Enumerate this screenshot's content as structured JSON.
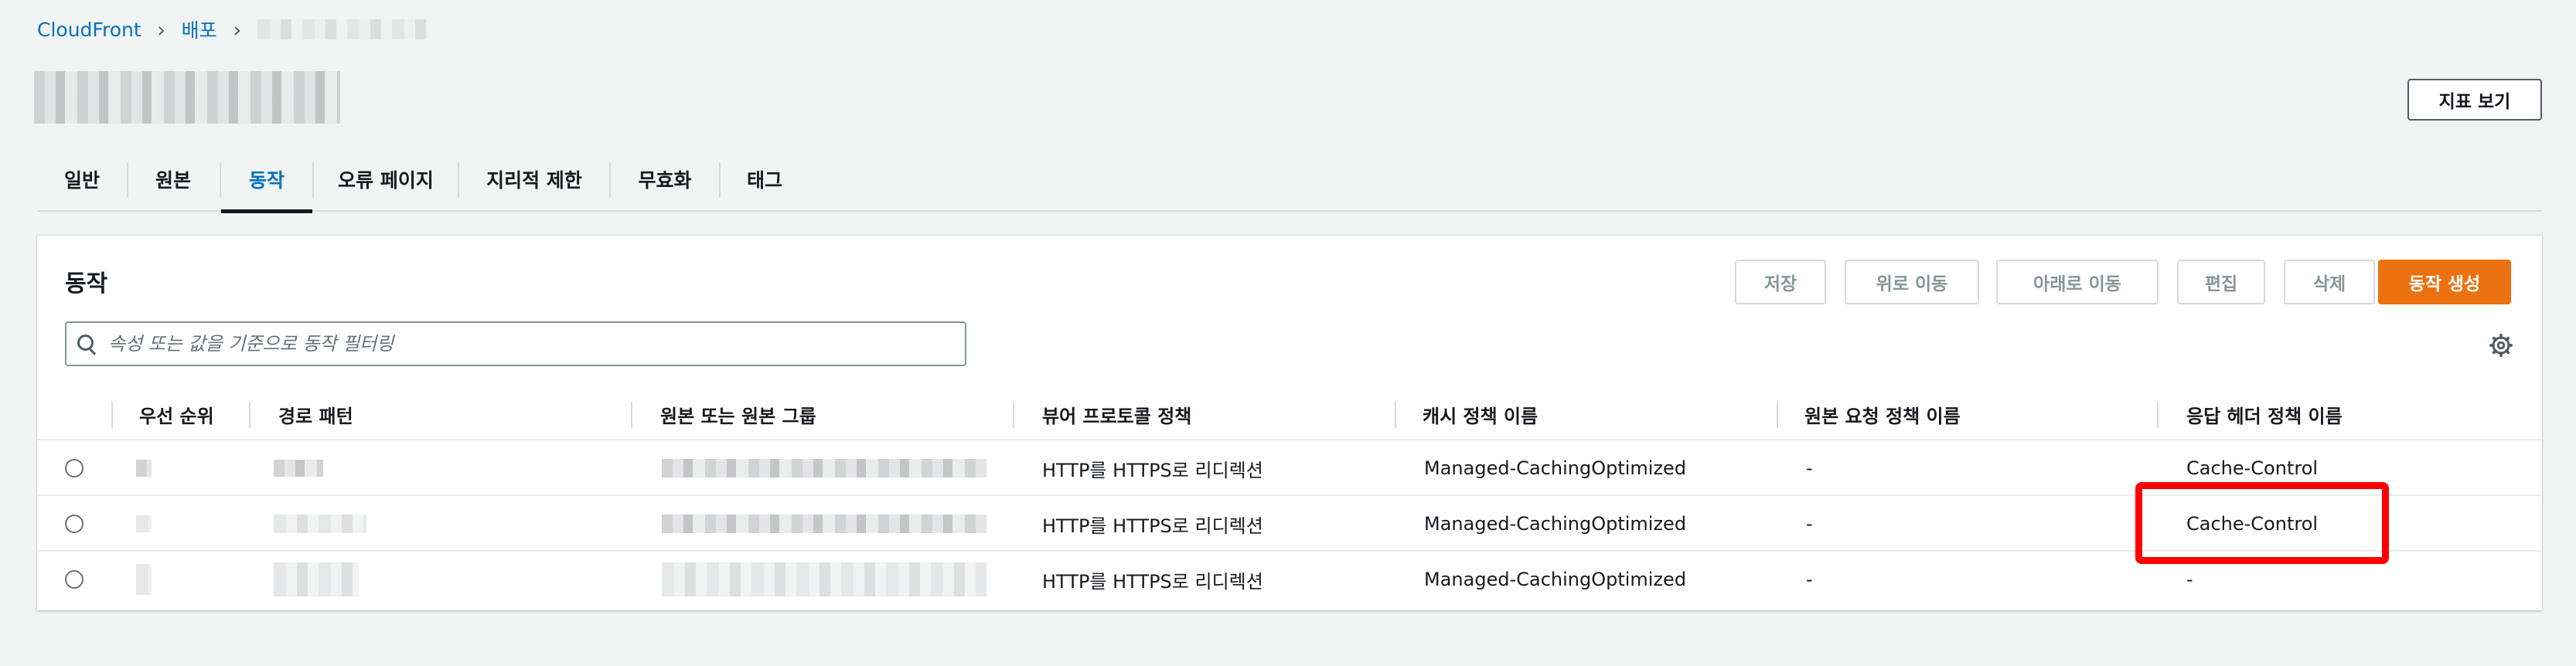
{
  "breadcrumb": {
    "root": "CloudFront",
    "section": "배포"
  },
  "header": {
    "metrics_button": "지표 보기"
  },
  "tabs": [
    {
      "label": "일반",
      "active": false
    },
    {
      "label": "원본",
      "active": false
    },
    {
      "label": "동작",
      "active": true
    },
    {
      "label": "오류 페이지",
      "active": false
    },
    {
      "label": "지리적 제한",
      "active": false
    },
    {
      "label": "무효화",
      "active": false
    },
    {
      "label": "태그",
      "active": false
    }
  ],
  "panel": {
    "title": "동작",
    "buttons": {
      "save": "저장",
      "move_up": "위로 이동",
      "move_down": "아래로 이동",
      "edit": "편집",
      "delete": "삭제",
      "create": "동작 생성"
    },
    "search_placeholder": "속성 또는 값을 기준으로 동작 필터링"
  },
  "table": {
    "columns": [
      "우선 순위",
      "경로 패턴",
      "원본 또는 원본 그룹",
      "뷰어 프로토콜 정책",
      "캐시 정책 이름",
      "원본 요청 정책 이름",
      "응답 헤더 정책 이름"
    ],
    "rows": [
      {
        "viewer_protocol": "HTTP를 HTTPS로 리디렉션",
        "cache_policy": "Managed-CachingOptimized",
        "origin_request_policy": "-",
        "response_headers_policy": "Cache-Control"
      },
      {
        "viewer_protocol": "HTTP를 HTTPS로 리디렉션",
        "cache_policy": "Managed-CachingOptimized",
        "origin_request_policy": "-",
        "response_headers_policy": "Cache-Control"
      },
      {
        "viewer_protocol": "HTTP를 HTTPS로 리디렉션",
        "cache_policy": "Managed-CachingOptimized",
        "origin_request_policy": "-",
        "response_headers_policy": "-"
      }
    ]
  },
  "colors": {
    "link": "#0073bb",
    "primary": "#ec7211",
    "highlight": "#ff0000"
  }
}
